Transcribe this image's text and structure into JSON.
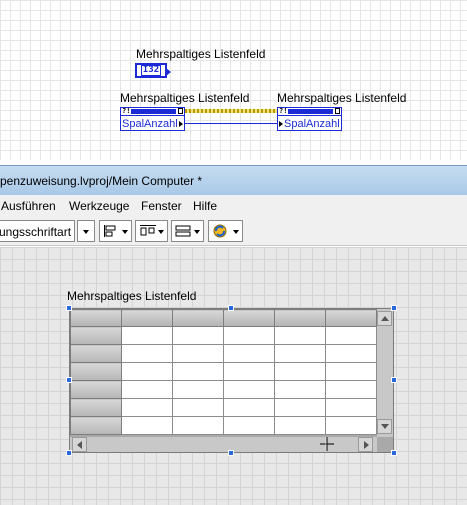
{
  "block_diagram": {
    "control_label": "Mehrspaltiges Listenfeld",
    "control_terminal": "I32",
    "node1": {
      "label": "Mehrspaltiges Listenfeld",
      "property": "SpalAnzahl",
      "ref_tag": "?!"
    },
    "node2": {
      "label": "Mehrspaltiges Listenfeld",
      "property": "SpalAnzahl",
      "ref_tag": "?!"
    }
  },
  "window": {
    "title": "penzuweisung.lvproj/Mein Computer *"
  },
  "menu": {
    "items": [
      "Ausführen",
      "Werkzeuge",
      "Fenster",
      "Hilfe"
    ]
  },
  "toolbar": {
    "font_select": "ungsschriftart",
    "buttons": [
      "align-objects-icon",
      "distribute-objects-icon",
      "resize-objects-icon",
      "reorder-icon"
    ]
  },
  "front_panel": {
    "listbox_label": "Mehrspaltiges Listenfeld",
    "columns": 5,
    "rows": 6
  }
}
